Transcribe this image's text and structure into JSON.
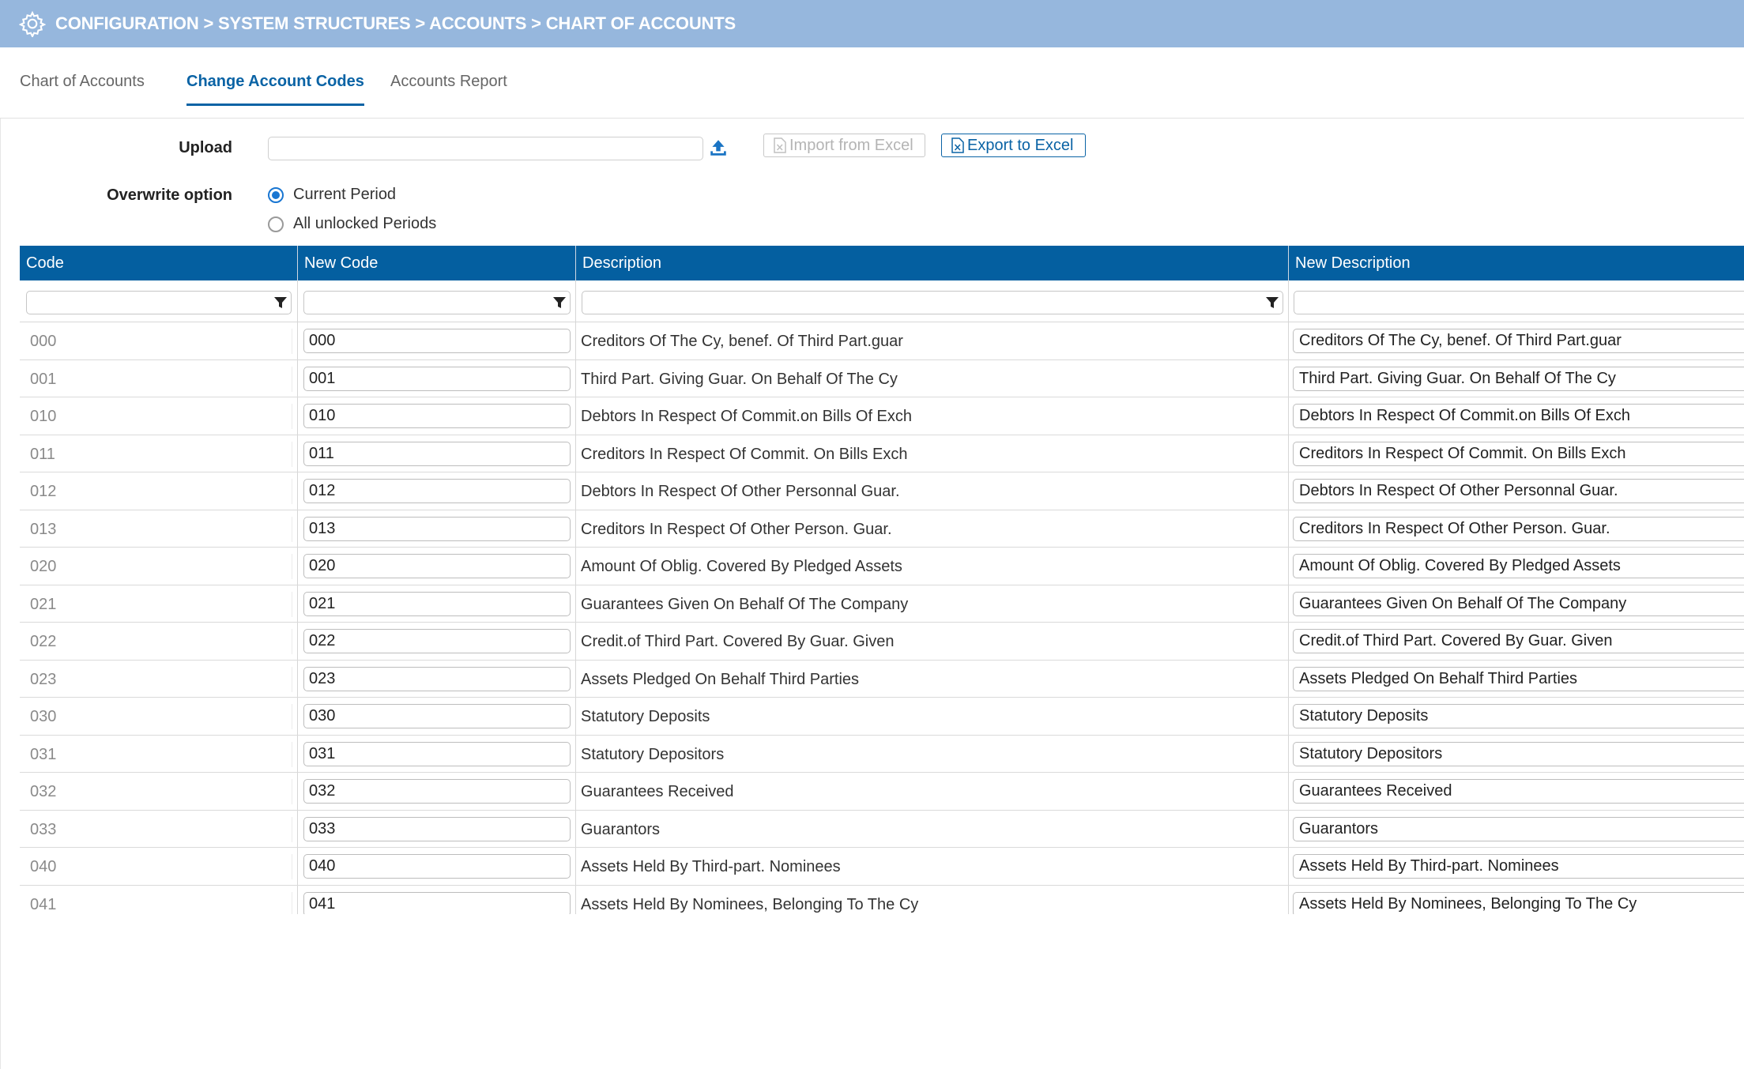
{
  "breadcrumb": "CONFIGURATION > SYSTEM STRUCTURES > ACCOUNTS > CHART OF ACCOUNTS",
  "tabs": [
    {
      "label": "Chart of Accounts",
      "active": false
    },
    {
      "label": "Change Account Codes",
      "active": true
    },
    {
      "label": "Accounts Report",
      "active": false
    }
  ],
  "form": {
    "upload_label": "Upload",
    "upload_value": "",
    "import_label": "Import from Excel",
    "export_label": "Export to Excel",
    "overwrite_label": "Overwrite option",
    "options": [
      {
        "label": "Current Period",
        "selected": true
      },
      {
        "label": "All unlocked Periods",
        "selected": false
      }
    ]
  },
  "grid": {
    "columns": [
      "Code",
      "New Code",
      "Description",
      "New Description"
    ],
    "rows": [
      {
        "code": "000",
        "new_code": "000",
        "description": "Creditors Of The Cy, benef. Of Third Part.guar",
        "new_description": "Creditors Of The Cy, benef. Of Third Part.guar"
      },
      {
        "code": "001",
        "new_code": "001",
        "description": "Third Part. Giving Guar. On Behalf Of The Cy",
        "new_description": "Third Part. Giving Guar. On Behalf Of The Cy"
      },
      {
        "code": "010",
        "new_code": "010",
        "description": "Debtors In Respect Of Commit.on Bills Of Exch",
        "new_description": "Debtors In Respect Of Commit.on Bills Of Exch"
      },
      {
        "code": "011",
        "new_code": "011",
        "description": "Creditors In Respect Of Commit. On Bills Exch",
        "new_description": "Creditors In Respect Of Commit. On Bills Exch"
      },
      {
        "code": "012",
        "new_code": "012",
        "description": "Debtors In Respect Of Other Personnal Guar.",
        "new_description": "Debtors In Respect Of Other Personnal Guar."
      },
      {
        "code": "013",
        "new_code": "013",
        "description": "Creditors In Respect Of Other Person. Guar.",
        "new_description": "Creditors In Respect Of Other Person. Guar."
      },
      {
        "code": "020",
        "new_code": "020",
        "description": "Amount Of Oblig. Covered By Pledged Assets",
        "new_description": "Amount Of Oblig. Covered By Pledged Assets"
      },
      {
        "code": "021",
        "new_code": "021",
        "description": "Guarantees Given On Behalf Of The Company",
        "new_description": "Guarantees Given On Behalf Of The Company"
      },
      {
        "code": "022",
        "new_code": "022",
        "description": "Credit.of Third Part. Covered By Guar. Given",
        "new_description": "Credit.of Third Part. Covered By Guar. Given"
      },
      {
        "code": "023",
        "new_code": "023",
        "description": "Assets Pledged On Behalf Third Parties",
        "new_description": "Assets Pledged On Behalf Third Parties"
      },
      {
        "code": "030",
        "new_code": "030",
        "description": "Statutory Deposits",
        "new_description": "Statutory Deposits"
      },
      {
        "code": "031",
        "new_code": "031",
        "description": "Statutory Depositors",
        "new_description": "Statutory Depositors"
      },
      {
        "code": "032",
        "new_code": "032",
        "description": "Guarantees Received",
        "new_description": "Guarantees Received"
      },
      {
        "code": "033",
        "new_code": "033",
        "description": "Guarantors",
        "new_description": "Guarantors"
      },
      {
        "code": "040",
        "new_code": "040",
        "description": "Assets Held By Third-part. Nominees",
        "new_description": "Assets Held By Third-part. Nominees"
      },
      {
        "code": "041",
        "new_code": "041",
        "description": "Assets Held By Nominees, Belonging To The Cy",
        "new_description": "Assets Held By Nominees, Belonging To The Cy"
      }
    ]
  },
  "colors": {
    "topbar": "#96b7dd",
    "header": "#045fa0",
    "accent": "#0a63a5",
    "radio": "#1976d2"
  },
  "icons": [
    "settings-gear-icon",
    "upload-icon",
    "excel-file-icon",
    "filter-funnel-icon"
  ]
}
